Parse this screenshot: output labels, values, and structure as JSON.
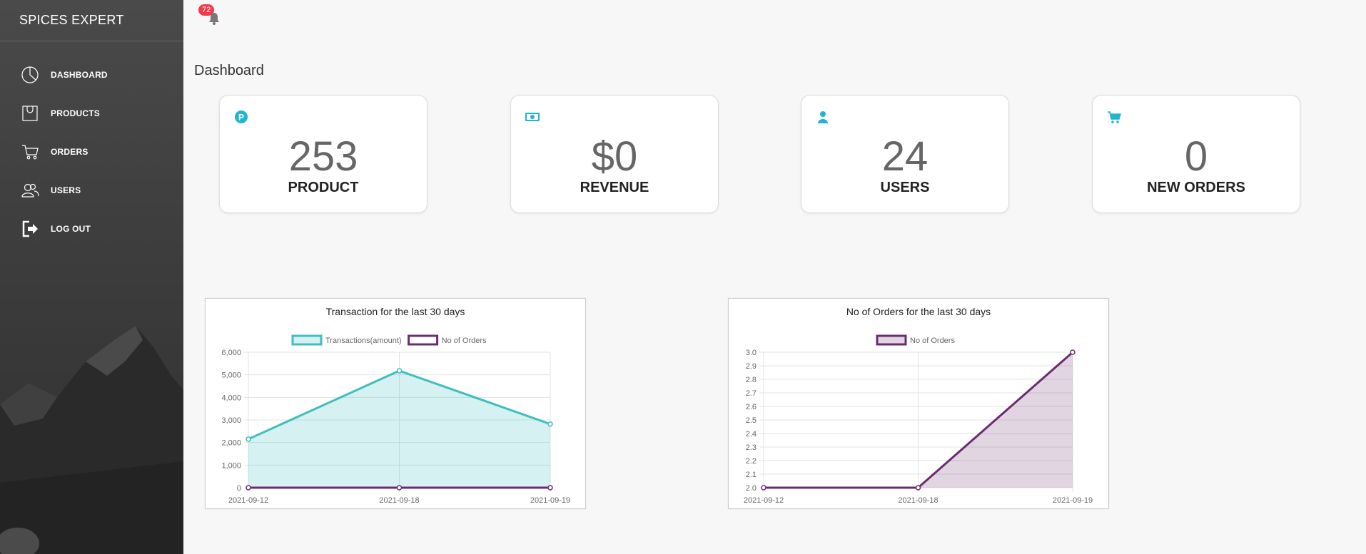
{
  "sidebar": {
    "brand": "SPICES EXPERT",
    "items": [
      {
        "label": "DASHBOARD",
        "icon": "pie-chart-icon"
      },
      {
        "label": "PRODUCTS",
        "icon": "shopping-bag-icon"
      },
      {
        "label": "ORDERS",
        "icon": "cart-icon"
      },
      {
        "label": "USERS",
        "icon": "users-icon"
      },
      {
        "label": "LOG OUT",
        "icon": "logout-icon"
      }
    ]
  },
  "notifications": {
    "count": "72",
    "icon": "bell-icon"
  },
  "page_title": "Dashboard",
  "stats": [
    {
      "value": "253",
      "label": "PRODUCT",
      "icon": "product-p-icon"
    },
    {
      "value": "$0",
      "label": "REVENUE",
      "icon": "money-icon"
    },
    {
      "value": "24",
      "label": "USERS",
      "icon": "user-icon"
    },
    {
      "value": "0",
      "label": "NEW ORDERS",
      "icon": "cart-icon"
    }
  ],
  "colors": {
    "accent": "#1fb5d1",
    "teal_series": "#41bebe",
    "purple_series": "#6a2c70",
    "badge": "#ef3b4a"
  },
  "chart_data": [
    {
      "type": "area",
      "title": "Transaction for the last 30 days",
      "categories": [
        "2021-09-12",
        "2021-09-18",
        "2021-09-19"
      ],
      "series": [
        {
          "name": "Transactions(amount)",
          "values": [
            2150,
            5180,
            2820
          ],
          "color": "#41bebe",
          "fill": "rgba(65,190,190,0.22)"
        },
        {
          "name": "No of Orders",
          "values": [
            0,
            0,
            0
          ],
          "color": "#6a2c70",
          "fill": "none"
        }
      ],
      "ylim": [
        0,
        6000
      ],
      "yticks": [
        0,
        1000,
        2000,
        3000,
        4000,
        5000,
        6000
      ],
      "ytick_labels": [
        "0",
        "1,000",
        "2,000",
        "3,000",
        "4,000",
        "5,000",
        "6,000"
      ],
      "legend": "top",
      "grid": true
    },
    {
      "type": "area",
      "title": "No of Orders for the last 30 days",
      "categories": [
        "2021-09-12",
        "2021-09-18",
        "2021-09-19"
      ],
      "series": [
        {
          "name": "No of Orders",
          "values": [
            2,
            2,
            3
          ],
          "color": "#6a2c70",
          "fill": "rgba(106,44,112,0.2)"
        }
      ],
      "ylim": [
        2.0,
        3.0
      ],
      "yticks": [
        2.0,
        2.1,
        2.2,
        2.3,
        2.4,
        2.5,
        2.6,
        2.7,
        2.8,
        2.9,
        3.0
      ],
      "ytick_labels": [
        "2.0",
        "2.1",
        "2.2",
        "2.3",
        "2.4",
        "2.5",
        "2.6",
        "2.7",
        "2.8",
        "2.9",
        "3.0"
      ],
      "legend": "top",
      "grid": true
    }
  ]
}
